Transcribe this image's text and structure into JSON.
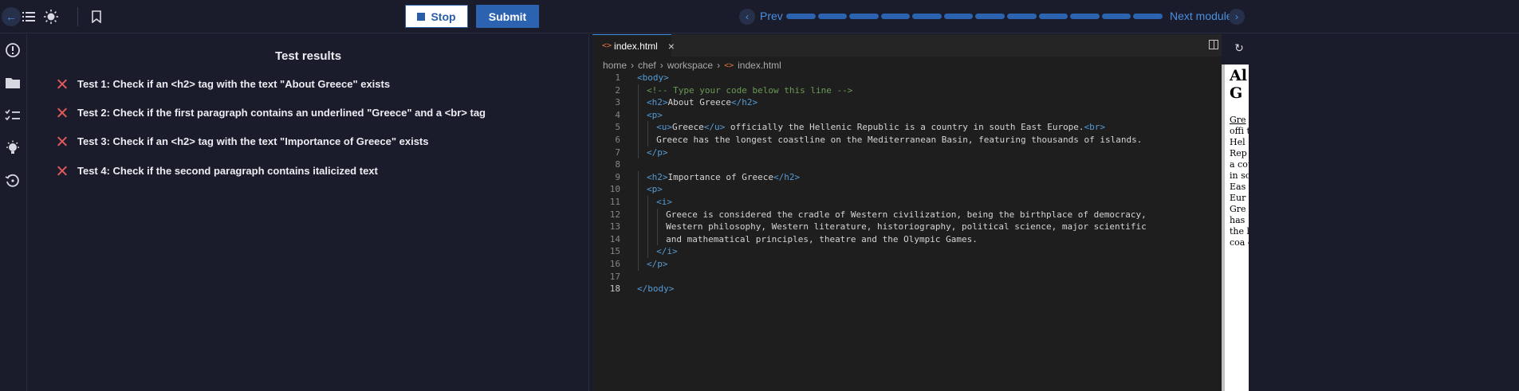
{
  "toolbar": {
    "stop_label": "Stop",
    "submit_label": "Submit",
    "prev_label": "Prev",
    "next_label": "Next module",
    "progress_segments": 12,
    "progress_filled": 12
  },
  "results": {
    "title": "Test results",
    "tests": [
      {
        "status": "failed",
        "label": "Test 1: Check if an <h2> tag with the text \"About Greece\" exists"
      },
      {
        "status": "failed",
        "label": "Test 2: Check if the first paragraph contains an underlined \"Greece\" and a <br> tag"
      },
      {
        "status": "failed",
        "label": "Test 3: Check if an <h2> tag with the text \"Importance of Greece\" exists"
      },
      {
        "status": "failed",
        "label": "Test 4: Check if the second paragraph contains italicized text"
      }
    ]
  },
  "editor": {
    "tab": {
      "icon": "<>",
      "filename": "index.html",
      "close": "×"
    },
    "breadcrumb": {
      "parts": [
        "home",
        "chef",
        "workspace"
      ],
      "file_icon": "<>",
      "file": "index.html"
    },
    "active_line": 18,
    "lines": [
      {
        "n": "1",
        "indent": 0,
        "tokens": [
          {
            "c": "tag",
            "t": "<body>"
          }
        ]
      },
      {
        "n": "2",
        "indent": 1,
        "tokens": [
          {
            "c": "cmt",
            "t": "<!-- Type your code below this line -->"
          }
        ]
      },
      {
        "n": "3",
        "indent": 1,
        "tokens": [
          {
            "c": "tag",
            "t": "<h2>"
          },
          {
            "c": "txt",
            "t": "About Greece"
          },
          {
            "c": "tag",
            "t": "</h2>"
          }
        ]
      },
      {
        "n": "4",
        "indent": 1,
        "tokens": [
          {
            "c": "tag",
            "t": "<p>"
          }
        ]
      },
      {
        "n": "5",
        "indent": 2,
        "tokens": [
          {
            "c": "tag",
            "t": "<u>"
          },
          {
            "c": "txt",
            "t": "Greece"
          },
          {
            "c": "tag",
            "t": "</u>"
          },
          {
            "c": "txt",
            "t": " officially the Hellenic Republic is a country in south East Europe."
          },
          {
            "c": "tag",
            "t": "<br>"
          }
        ]
      },
      {
        "n": "6",
        "indent": 2,
        "tokens": [
          {
            "c": "txt",
            "t": "Greece has the longest coastline on the Mediterranean Basin, featuring thousands of islands."
          }
        ]
      },
      {
        "n": "7",
        "indent": 1,
        "tokens": [
          {
            "c": "tag",
            "t": "</p>"
          }
        ]
      },
      {
        "n": "8",
        "indent": 0,
        "tokens": []
      },
      {
        "n": "9",
        "indent": 1,
        "tokens": [
          {
            "c": "tag",
            "t": "<h2>"
          },
          {
            "c": "txt",
            "t": "Importance of Greece"
          },
          {
            "c": "tag",
            "t": "</h2>"
          }
        ]
      },
      {
        "n": "10",
        "indent": 1,
        "tokens": [
          {
            "c": "tag",
            "t": "<p>"
          }
        ]
      },
      {
        "n": "11",
        "indent": 2,
        "tokens": [
          {
            "c": "tag",
            "t": "<i>"
          }
        ]
      },
      {
        "n": "12",
        "indent": 3,
        "tokens": [
          {
            "c": "txt",
            "t": "Greece is considered the cradle of Western civilization, being the birthplace of democracy,"
          }
        ]
      },
      {
        "n": "13",
        "indent": 3,
        "tokens": [
          {
            "c": "txt",
            "t": "Western philosophy, Western literature, historiography, political science, major scientific"
          }
        ]
      },
      {
        "n": "14",
        "indent": 3,
        "tokens": [
          {
            "c": "txt",
            "t": "and mathematical principles, theatre and the Olympic Games."
          }
        ]
      },
      {
        "n": "15",
        "indent": 2,
        "tokens": [
          {
            "c": "tag",
            "t": "</i>"
          }
        ]
      },
      {
        "n": "16",
        "indent": 1,
        "tokens": [
          {
            "c": "tag",
            "t": "</p>"
          }
        ]
      },
      {
        "n": "17",
        "indent": 0,
        "tokens": []
      },
      {
        "n": "18",
        "indent": 0,
        "tokens": [
          {
            "c": "tag",
            "t": "</body>"
          }
        ]
      }
    ]
  },
  "preview": {
    "heading": "Al G",
    "para_underlined": "Gre",
    "para_rest": "offi the Hel Rep is a cou in sou Eas Eur Gre has the lon coa on"
  },
  "colors": {
    "accent": "#2c63b0",
    "fail": "#e05a5a",
    "link": "#4b8fe0"
  }
}
